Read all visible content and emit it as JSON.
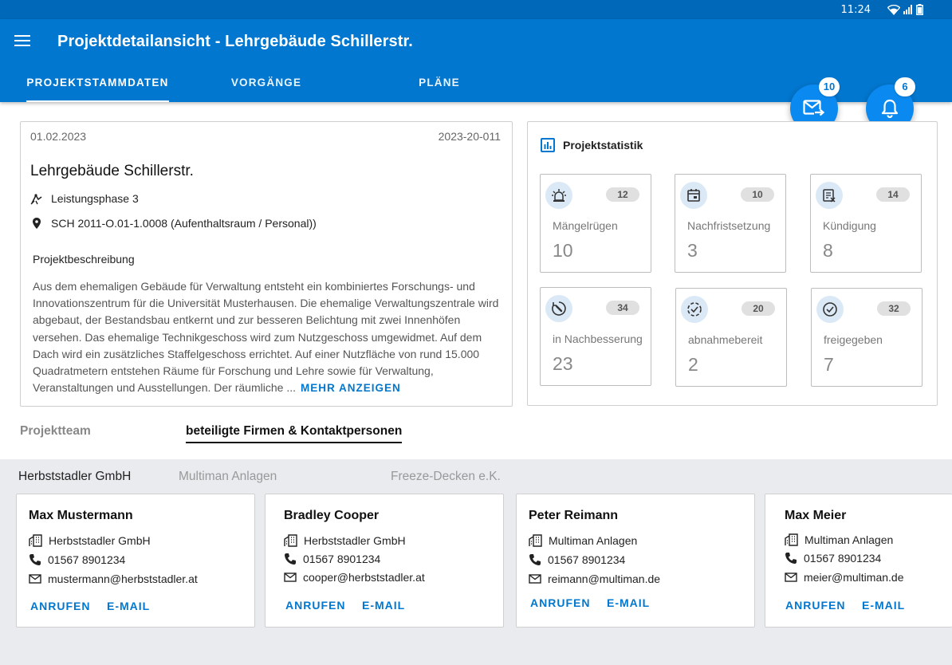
{
  "statusbar": {
    "time": "11:24"
  },
  "appbar": {
    "title": "Projektdetailansicht - Lehrgebäude Schillerstr."
  },
  "tabs": [
    {
      "label": "PROJEKTSTAMMDATEN"
    },
    {
      "label": "VORGÄNGE"
    },
    {
      "label": "PLÄNE"
    }
  ],
  "fabs": {
    "mail_count": "10",
    "notification_count": "6"
  },
  "project": {
    "date": "01.02.2023",
    "number": "2023-20-011",
    "title": "Lehrgebäude Schillerstr.",
    "phase": "Leistungsphase 3",
    "location": "SCH 2011-O.01-1.0008 (Aufenthaltsraum / Personal))",
    "description_title": "Projektbeschreibung",
    "description": "Aus dem ehemaligen Gebäude für Verwaltung entsteht ein kombiniertes Forschungs- und Innovationszentrum für die Universität Musterhausen. Die ehemalige Verwaltungszentrale wird abgebaut, der Bestandsbau entkernt und zur besseren Belichtung mit zwei Innenhöfen versehen. Das ehemalige Technikgeschoss wird zum Nutzgeschoss umgewidmet. Auf dem Dach wird ein zusätzliches Staffelgeschoss errichtet. Auf einer Nutzfläche von rund 15.000 Quadratmetern entstehen Räume für Forschung und Lehre sowie für Verwaltung, Veranstaltungen und Ausstellungen. Der räumliche ...",
    "more_label": "MEHR ANZEIGEN"
  },
  "stats": {
    "title": "Projektstatistik",
    "tiles": [
      {
        "label": "Mängelrügen",
        "count": "12",
        "value": "10",
        "icon": "alarm-light-icon"
      },
      {
        "label": "Nachfristsetzung",
        "count": "10",
        "value": "3",
        "icon": "calendar-icon"
      },
      {
        "label": "Kündigung",
        "count": "14",
        "value": "8",
        "icon": "document-cancel-icon"
      },
      {
        "label": "in Nachbesserung",
        "count": "34",
        "value": "23",
        "icon": "wrench-icon"
      },
      {
        "label": "abnahmebereit",
        "count": "20",
        "value": "2",
        "icon": "progress-check-icon"
      },
      {
        "label": "freigegeben",
        "count": "32",
        "value": "7",
        "icon": "check-circle-icon"
      }
    ]
  },
  "subtabs": [
    {
      "label": "Projektteam"
    },
    {
      "label": "beteiligte Firmen & Kontaktpersonen"
    }
  ],
  "company_tabs": [
    {
      "label": "Herbststadler GmbH"
    },
    {
      "label": "Multiman Anlagen"
    },
    {
      "label": "Freeze-Decken e.K."
    }
  ],
  "contacts": [
    {
      "name": "Max Mustermann",
      "company": "Herbststadler GmbH",
      "phone": "01567 8901234",
      "email": "mustermann@herbststadler.at",
      "call_label": "ANRUFEN",
      "mail_label": "E-MAIL"
    },
    {
      "name": "Bradley Cooper",
      "company": "Herbststadler GmbH",
      "phone": "01567 8901234",
      "email": "cooper@herbststadler.at",
      "call_label": "ANRUFEN",
      "mail_label": "E-MAIL"
    },
    {
      "name": "Peter Reimann",
      "company": "Multiman Anlagen",
      "phone": "01567 8901234",
      "email": "reimann@multiman.de",
      "call_label": "ANRUFEN",
      "mail_label": "E-MAIL"
    },
    {
      "name": "Max Meier",
      "company": "Multiman Anlagen",
      "phone": "01567 8901234",
      "email": "meier@multiman.de",
      "call_label": "ANRUFEN",
      "mail_label": "E-MAIL"
    }
  ],
  "colors": {
    "primary": "#0277cf",
    "fab": "#0a8af0",
    "statusbar": "#0068b8",
    "background_alt": "#e9ebee"
  }
}
